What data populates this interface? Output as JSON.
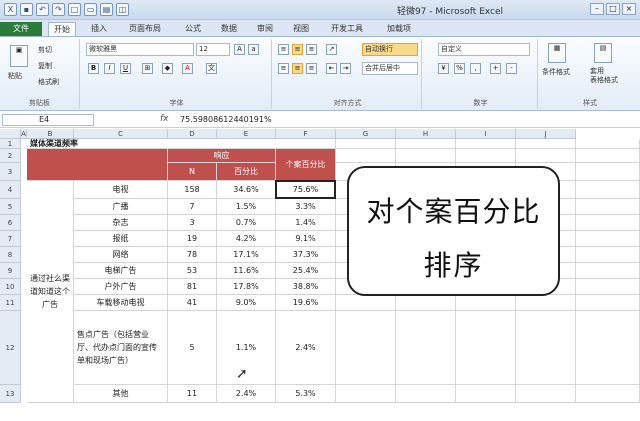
{
  "window": {
    "title": "轻微97 - Microsoft Excel"
  },
  "tabs": [
    "开始",
    "插入",
    "页面布局",
    "公式",
    "数据",
    "审阅",
    "视图",
    "开发工具",
    "加载项"
  ],
  "ribbon": {
    "paste": "粘贴",
    "cut": "剪切",
    "copy": "复制",
    "format_painter": "格式刷",
    "clipboard": "剪贴板",
    "font_name": "微软雅黑",
    "font_size": "12",
    "font_group": "字体",
    "wrap_text": "自动换行",
    "merge_center": "合并后居中",
    "alignment_group": "对齐方式",
    "number_format": "自定义",
    "number_group": "数字",
    "cond_format": "条件格式",
    "table_format": "套用\n表格格式",
    "cell_styles": "单元格\n样式",
    "styles_group": "样式"
  },
  "formula_bar": {
    "cell": "E4",
    "fx": "fx",
    "value": "75.59808612440191%"
  },
  "columns": [
    "A",
    "B",
    "C",
    "D",
    "E",
    "F",
    "G",
    "H",
    "I",
    "J"
  ],
  "rows": [
    "1",
    "2",
    "3",
    "4",
    "5",
    "6",
    "7",
    "8",
    "9",
    "10",
    "11",
    "12",
    "13"
  ],
  "sheet": {
    "title": "媒体渠道频率",
    "header_response": "响应",
    "header_case_pct": "个案百分比",
    "header_n": "N",
    "header_pct": "百分比",
    "group_label": "通过社么渠道知道这个广告",
    "items": [
      {
        "name": "电视",
        "n": "158",
        "pct": "34.6%",
        "case": "75.6%"
      },
      {
        "name": "广播",
        "n": "7",
        "pct": "1.5%",
        "case": "3.3%"
      },
      {
        "name": "杂志",
        "n": "3",
        "pct": "0.7%",
        "case": "1.4%"
      },
      {
        "name": "报纸",
        "n": "19",
        "pct": "4.2%",
        "case": "9.1%"
      },
      {
        "name": "网络",
        "n": "78",
        "pct": "17.1%",
        "case": "37.3%"
      },
      {
        "name": "电梯广告",
        "n": "53",
        "pct": "11.6%",
        "case": "25.4%"
      },
      {
        "name": "户外广告",
        "n": "81",
        "pct": "17.8%",
        "case": "38.8%"
      },
      {
        "name": "车载移动电视",
        "n": "41",
        "pct": "9.0%",
        "case": "19.6%"
      },
      {
        "name": "售点广告（包括营业厅、代办点门面的宣传单和现场广告）",
        "n": "5",
        "pct": "1.1%",
        "case": "2.4%"
      },
      {
        "name": "其他",
        "n": "11",
        "pct": "2.4%",
        "case": "5.3%"
      }
    ]
  },
  "callout": {
    "line1": "对个案百分比",
    "line2": "排序"
  }
}
